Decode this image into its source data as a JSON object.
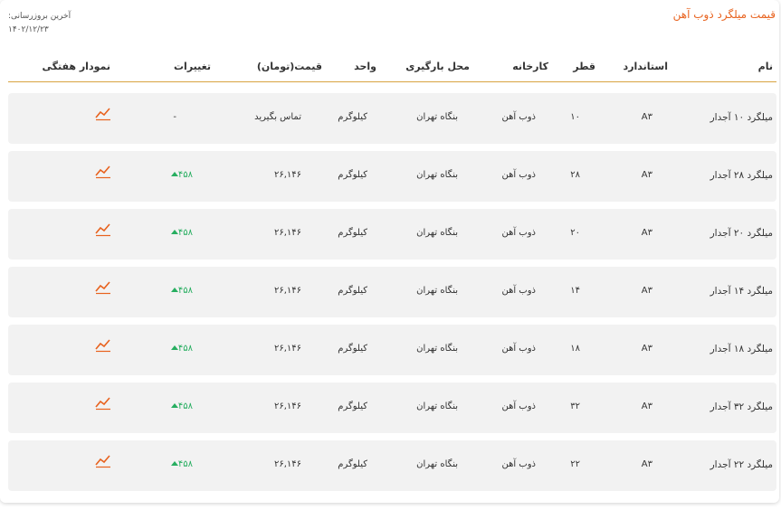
{
  "title": "قیمت میلگرد ذوب آهن",
  "updated": {
    "label": "آخرین بروزرسانی:",
    "date": "۱۴۰۲/۱۲/۲۳"
  },
  "headers": {
    "name": "نام",
    "standard": "استاندارد",
    "diameter": "قطر",
    "factory": "کارخانه",
    "loading": "محل بارگیری",
    "unit": "واحد",
    "price": "قیمت(تومان)",
    "change": "تغییرات",
    "chart": "نمودار هفتگی"
  },
  "colors": {
    "accent": "#e8621e",
    "positive": "#27ae60",
    "divider": "#d9a441"
  },
  "chart_icon": "trend-line-icon",
  "rows": [
    {
      "name": "میلگرد ۱۰ آجدار",
      "standard": "A۳",
      "diameter": "۱۰",
      "factory": "ذوب آهن",
      "loading": "بنگاه تهران",
      "unit": "کیلوگرم",
      "price": "تماس بگیرید",
      "change": "-",
      "up": false
    },
    {
      "name": "میلگرد ۲۸ آجدار",
      "standard": "A۳",
      "diameter": "۲۸",
      "factory": "ذوب آهن",
      "loading": "بنگاه تهران",
      "unit": "کیلوگرم",
      "price": "۲۶,۱۴۶",
      "change": "۴۵۸",
      "up": true
    },
    {
      "name": "میلگرد ۲۰ آجدار",
      "standard": "A۳",
      "diameter": "۲۰",
      "factory": "ذوب آهن",
      "loading": "بنگاه تهران",
      "unit": "کیلوگرم",
      "price": "۲۶,۱۴۶",
      "change": "۴۵۸",
      "up": true
    },
    {
      "name": "میلگرد ۱۴ آجدار",
      "standard": "A۳",
      "diameter": "۱۴",
      "factory": "ذوب آهن",
      "loading": "بنگاه تهران",
      "unit": "کیلوگرم",
      "price": "۲۶,۱۴۶",
      "change": "۴۵۸",
      "up": true
    },
    {
      "name": "میلگرد ۱۸ آجدار",
      "standard": "A۳",
      "diameter": "۱۸",
      "factory": "ذوب آهن",
      "loading": "بنگاه تهران",
      "unit": "کیلوگرم",
      "price": "۲۶,۱۴۶",
      "change": "۴۵۸",
      "up": true
    },
    {
      "name": "میلگرد ۳۲ آجدار",
      "standard": "A۳",
      "diameter": "۳۲",
      "factory": "ذوب آهن",
      "loading": "بنگاه تهران",
      "unit": "کیلوگرم",
      "price": "۲۶,۱۴۶",
      "change": "۴۵۸",
      "up": true
    },
    {
      "name": "میلگرد ۲۲ آجدار",
      "standard": "A۳",
      "diameter": "۲۲",
      "factory": "ذوب آهن",
      "loading": "بنگاه تهران",
      "unit": "کیلوگرم",
      "price": "۲۶,۱۴۶",
      "change": "۴۵۸",
      "up": true
    }
  ]
}
